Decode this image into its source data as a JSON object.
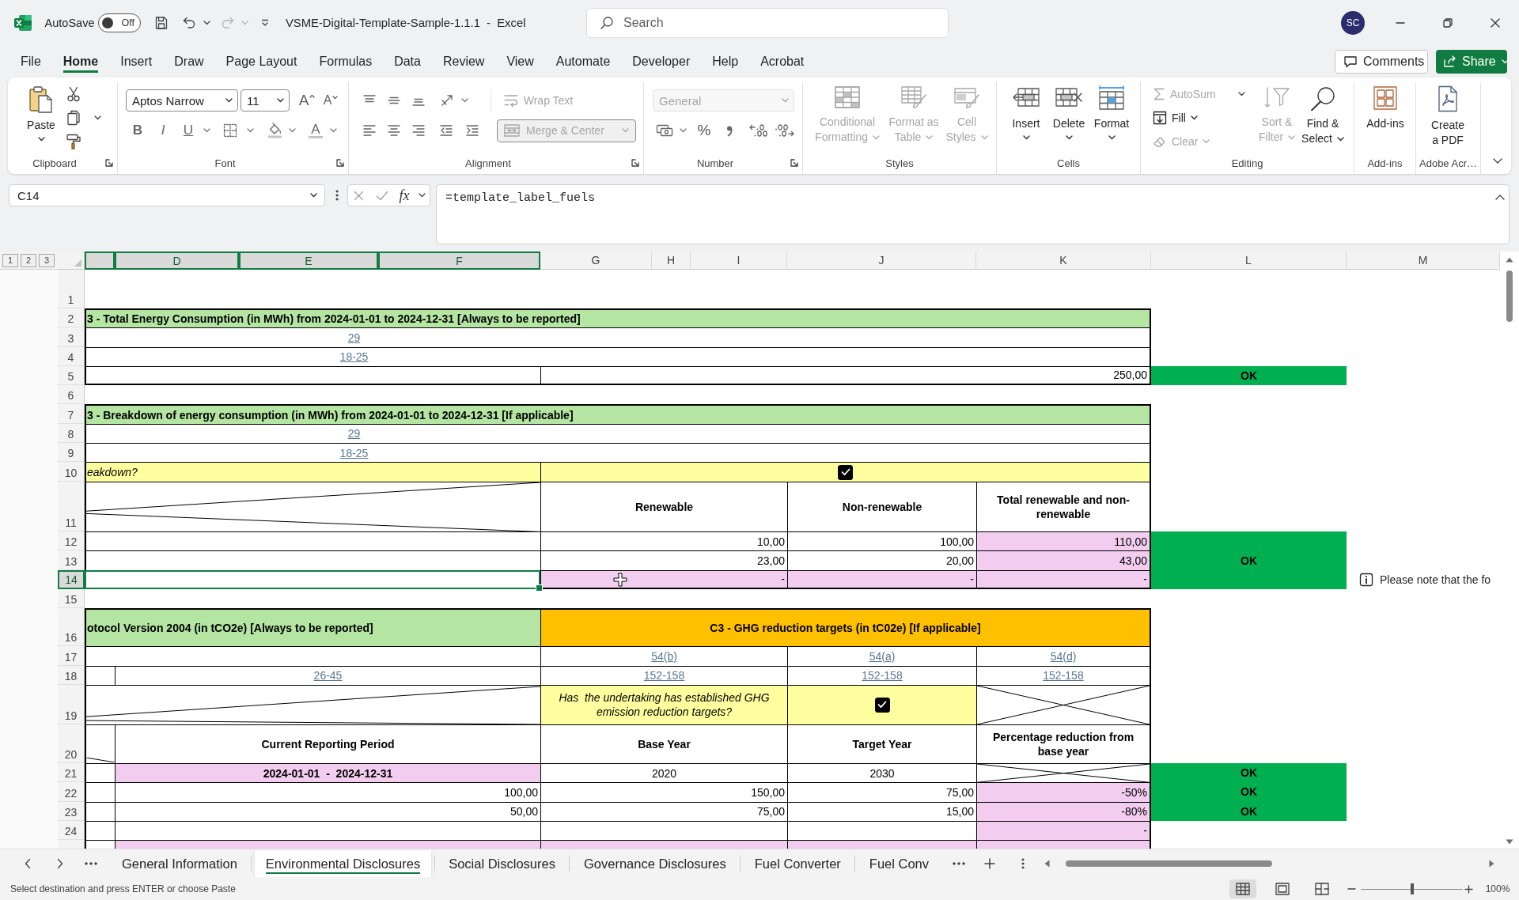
{
  "title_bar": {
    "autosave": {
      "label": "AutoSave",
      "on": false,
      "state": "Off"
    },
    "quick_access": [
      {
        "kind": "save",
        "disabled": false
      },
      {
        "kind": "undo",
        "disabled": false
      },
      {
        "kind": "redo",
        "disabled": true
      }
    ],
    "document_title": "VSME-Digital-Template-Sample-1.1.1  -  Excel",
    "search": {
      "placeholder": "Search"
    },
    "account": "SC"
  },
  "menu_tabs": [
    {
      "label": "File",
      "selected": false
    },
    {
      "label": "Home",
      "selected": true
    },
    {
      "label": "Insert",
      "selected": false
    },
    {
      "label": "Draw",
      "selected": false
    },
    {
      "label": "Page Layout",
      "selected": false
    },
    {
      "label": "Formulas",
      "selected": false
    },
    {
      "label": "Data",
      "selected": false
    },
    {
      "label": "Review",
      "selected": false
    },
    {
      "label": "View",
      "selected": false
    },
    {
      "label": "Automate",
      "selected": false
    },
    {
      "label": "Developer",
      "selected": false
    },
    {
      "label": "Help",
      "selected": false
    },
    {
      "label": "Acrobat",
      "selected": false
    }
  ],
  "actions": {
    "comments": "Comments",
    "share": "Share"
  },
  "ribbon": {
    "clipboard": {
      "label": "Clipboard",
      "paste": {
        "label": "Paste",
        "disabled": false
      }
    },
    "font": {
      "label": "Font",
      "font_name": "Aptos Narrow",
      "font_size": "11",
      "grow": "A",
      "shrink": "A",
      "styles": [
        "B",
        "I",
        "U"
      ],
      "font_color": "A"
    },
    "alignment": {
      "label": "Alignment",
      "wrap_text": {
        "label": "Wrap Text",
        "disabled": true
      },
      "merge": {
        "label": "Merge & Center",
        "disabled": true
      }
    },
    "number": {
      "label": "Number",
      "format": {
        "value": "General",
        "disabled": true
      },
      "percent": "%"
    },
    "styles": {
      "label": "Styles",
      "commands": [
        {
          "label": "Conditional Formatting",
          "disabled": true
        },
        {
          "label": "Format as Table",
          "disabled": true
        },
        {
          "label": "Cell Styles",
          "disabled": true
        }
      ]
    },
    "cells": {
      "label": "Cells",
      "commands": [
        {
          "label": "Insert",
          "disabled": false
        },
        {
          "label": "Delete",
          "disabled": false
        },
        {
          "label": "Format",
          "disabled": false
        }
      ]
    },
    "editing": {
      "label": "Editing",
      "commands": [
        {
          "label": "AutoSum",
          "disabled": true
        },
        {
          "label": "Fill",
          "disabled": false
        },
        {
          "label": "Clear",
          "disabled": true
        },
        {
          "label": "Sort & Filter",
          "disabled": true
        },
        {
          "label": "Find & Select",
          "disabled": false
        }
      ]
    },
    "add_ins": {
      "label": "Add-ins",
      "command": {
        "label": "Add-ins",
        "disabled": false
      }
    },
    "adobe": {
      "label": "Adobe Acr…",
      "command": {
        "label": "Create a PDF",
        "disabled": false
      }
    }
  },
  "formula_bar": {
    "name_box": "C14",
    "function_glyph": "fx",
    "formula": "=template_label_fuels"
  },
  "sheet": {
    "outline_levels": [
      "1",
      "2",
      "3"
    ],
    "columns": [
      {
        "selected": true
      },
      {
        "label": "D",
        "selected": true
      },
      {
        "label": "E",
        "selected": true
      },
      {
        "label": "F",
        "selected": true
      },
      {
        "label": "G",
        "selected": false
      },
      {
        "label": "H",
        "selected": false
      },
      {
        "label": "I",
        "selected": false
      },
      {
        "label": "J",
        "selected": false
      },
      {
        "label": "K",
        "selected": false
      },
      {
        "label": "L",
        "selected": false
      },
      {
        "label": "M",
        "selected": false
      }
    ],
    "rows": [
      {
        "number": "1",
        "selected": false
      },
      {
        "number": "2",
        "selected": false,
        "cells": [
          {
            "kind": "section",
            "color": "#b4e5a2",
            "text": "3 - Total Energy Consumption (in MWh) from 2024-01-01 to 2024-12-31 [Always to be reported]"
          }
        ]
      },
      {
        "number": "3",
        "selected": false,
        "cells": [
          {
            "kind": "link",
            "text": "29"
          }
        ]
      },
      {
        "number": "4",
        "selected": false,
        "cells": [
          {
            "kind": "link",
            "text": "18-25"
          }
        ]
      },
      {
        "number": "5",
        "selected": false,
        "cells": [
          {
            "kind": "value",
            "text": "250,00"
          },
          {
            "kind": "status",
            "text": "OK"
          }
        ]
      },
      {
        "number": "6",
        "selected": false
      },
      {
        "number": "7",
        "selected": false,
        "cells": [
          {
            "kind": "section",
            "color": "#b4e5a2",
            "text": "3 - Breakdown of energy consumption (in MWh) from 2024-01-01 to 2024-12-31 [If applicable]"
          }
        ]
      },
      {
        "number": "8",
        "selected": false,
        "cells": [
          {
            "kind": "link",
            "text": "29"
          }
        ]
      },
      {
        "number": "9",
        "selected": false,
        "cells": [
          {
            "kind": "link",
            "text": "18-25"
          }
        ]
      },
      {
        "number": "10",
        "selected": false,
        "cells": [
          {
            "kind": "question",
            "text": "eakdown?"
          },
          {
            "kind": "checkbox",
            "checked": true
          }
        ]
      },
      {
        "number": "11",
        "selected": false,
        "cells": [
          {
            "kind": "heading",
            "text": "Renewable"
          },
          {
            "kind": "heading",
            "text": "Non-renewable"
          },
          {
            "kind": "heading",
            "text": "Total renewable and non-renewable"
          }
        ]
      },
      {
        "number": "12",
        "selected": false,
        "cells": [
          {
            "kind": "value",
            "text": "10,00"
          },
          {
            "kind": "value",
            "text": "100,00"
          },
          {
            "kind": "computed",
            "text": "110,00"
          },
          {
            "kind": "status",
            "text": "OK"
          }
        ]
      },
      {
        "number": "13",
        "selected": false,
        "cells": [
          {
            "kind": "value",
            "text": "23,00"
          },
          {
            "kind": "value",
            "text": "20,00"
          },
          {
            "kind": "computed",
            "text": "43,00"
          }
        ]
      },
      {
        "number": "14",
        "selected": true,
        "cells": [
          {
            "kind": "computed",
            "text": "-"
          },
          {
            "kind": "computed",
            "text": "-"
          },
          {
            "kind": "computed",
            "text": "-"
          },
          {
            "kind": "note",
            "text": "Please note that the fo"
          }
        ]
      },
      {
        "number": "15",
        "selected": false
      },
      {
        "number": "16",
        "selected": false,
        "cells": [
          {
            "kind": "section",
            "color": "#b4e5a2",
            "text": "otocol Version 2004 (in tCO2e) [Always to be reported]"
          },
          {
            "kind": "section",
            "color": "#ffc000",
            "text": "C3 - GHG reduction targets (in tC02e) [If applicable]"
          }
        ]
      },
      {
        "number": "17",
        "selected": false,
        "cells": [
          {
            "kind": "link",
            "text": "54(b)"
          },
          {
            "kind": "link",
            "text": "54(a)"
          },
          {
            "kind": "link",
            "text": "54(d)"
          }
        ]
      },
      {
        "number": "18",
        "selected": false,
        "cells": [
          {
            "kind": "link",
            "text": "26-45"
          },
          {
            "kind": "link",
            "text": "152-158"
          },
          {
            "kind": "link",
            "text": "152-158"
          },
          {
            "kind": "link",
            "text": "152-158"
          }
        ]
      },
      {
        "number": "19",
        "selected": false,
        "cells": [
          {
            "kind": "question",
            "text": "Has  the undertaking has established GHG emission reduction targets?"
          },
          {
            "kind": "checkbox",
            "checked": true
          }
        ]
      },
      {
        "number": "20",
        "selected": false,
        "cells": [
          {
            "kind": "heading",
            "text": "Current Reporting Period"
          },
          {
            "kind": "heading",
            "text": "Base Year"
          },
          {
            "kind": "heading",
            "text": "Target Year"
          },
          {
            "kind": "heading",
            "text": "Percentage reduction from base year"
          }
        ]
      },
      {
        "number": "21",
        "selected": false,
        "cells": [
          {
            "kind": "period",
            "text": "2024-01-01  -  2024-12-31"
          },
          {
            "kind": "value",
            "text": "2020"
          },
          {
            "kind": "value",
            "text": "2030"
          },
          {
            "kind": "status",
            "text": "OK"
          }
        ]
      },
      {
        "number": "22",
        "selected": false,
        "cells": [
          {
            "kind": "value",
            "text": "100,00"
          },
          {
            "kind": "value",
            "text": "150,00"
          },
          {
            "kind": "value",
            "text": "75,00"
          },
          {
            "kind": "computed",
            "text": "-50%"
          },
          {
            "kind": "status",
            "text": "OK"
          }
        ]
      },
      {
        "number": "23",
        "selected": false,
        "cells": [
          {
            "kind": "value",
            "text": "50,00"
          },
          {
            "kind": "value",
            "text": "75,00"
          },
          {
            "kind": "value",
            "text": "15,00"
          },
          {
            "kind": "computed",
            "text": "-80%"
          },
          {
            "kind": "status",
            "text": "OK"
          }
        ]
      },
      {
        "number": "24",
        "selected": false,
        "cells": [
          {
            "kind": "computed",
            "text": "-"
          }
        ]
      },
      {
        "selected": false,
        "cells": [
          {
            "kind": "computed"
          },
          {
            "kind": "computed"
          },
          {
            "kind": "computed"
          },
          {
            "kind": "computed"
          }
        ]
      }
    ]
  },
  "sheet_tabs": [
    {
      "label": "General Information",
      "selected": false
    },
    {
      "label": "Environmental Disclosures",
      "selected": true
    },
    {
      "label": "Social Disclosures",
      "selected": false
    },
    {
      "label": "Governance Disclosures",
      "selected": false
    },
    {
      "label": "Fuel Converter",
      "selected": false
    },
    {
      "label": "Fuel Conv",
      "selected": false
    }
  ],
  "status_bar": {
    "message": "Select destination and press ENTER or choose Paste",
    "views": [
      {
        "kind": "normal",
        "selected": true
      },
      {
        "kind": "page_layout",
        "selected": false
      },
      {
        "kind": "page_break",
        "selected": false
      }
    ],
    "zoom": {
      "level": 0.5,
      "reading": "100%"
    }
  }
}
